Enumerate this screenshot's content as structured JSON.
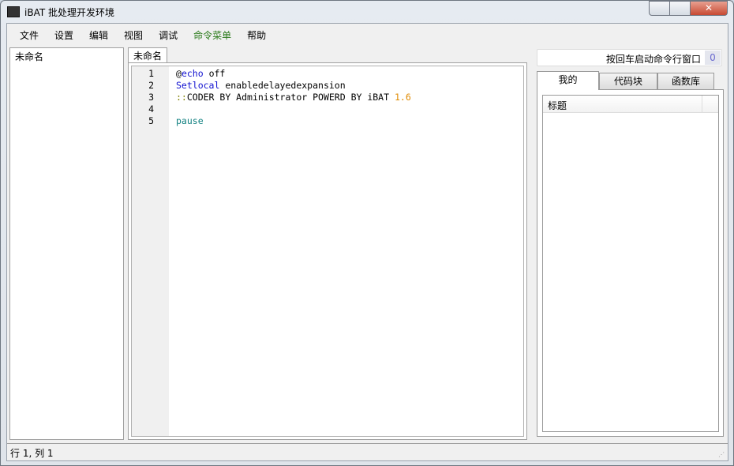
{
  "window": {
    "title": "iBAT 批处理开发环境",
    "close": "✕"
  },
  "menu": [
    "文件",
    "设置",
    "编辑",
    "视图",
    "调试",
    "命令菜单",
    "帮助"
  ],
  "explorer": {
    "item": "未命名"
  },
  "editor": {
    "tab": "未命名",
    "lines": [
      {
        "n": "1",
        "parts": [
          {
            "t": "@",
            "c": ""
          },
          {
            "t": "echo",
            "c": "kw"
          },
          {
            "t": " off",
            "c": ""
          }
        ]
      },
      {
        "n": "2",
        "parts": [
          {
            "t": "Setlocal",
            "c": "kw"
          },
          {
            "t": " enabledelayedexpansion",
            "c": ""
          }
        ]
      },
      {
        "n": "3",
        "parts": [
          {
            "t": "::",
            "c": "cm"
          },
          {
            "t": "CODER BY Administrator POWERD BY iBAT ",
            "c": ""
          },
          {
            "t": "1.6",
            "c": "num"
          }
        ]
      },
      {
        "n": "4",
        "parts": []
      },
      {
        "n": "5",
        "parts": [
          {
            "t": "pause",
            "c": "teal"
          }
        ]
      }
    ]
  },
  "cmd": {
    "label": "按回车启动命令行窗口",
    "count": "0"
  },
  "right_tabs": [
    "我的",
    "代码块",
    "函数库"
  ],
  "list": {
    "header": "标题"
  },
  "status": {
    "text": "行 1, 列 1"
  }
}
